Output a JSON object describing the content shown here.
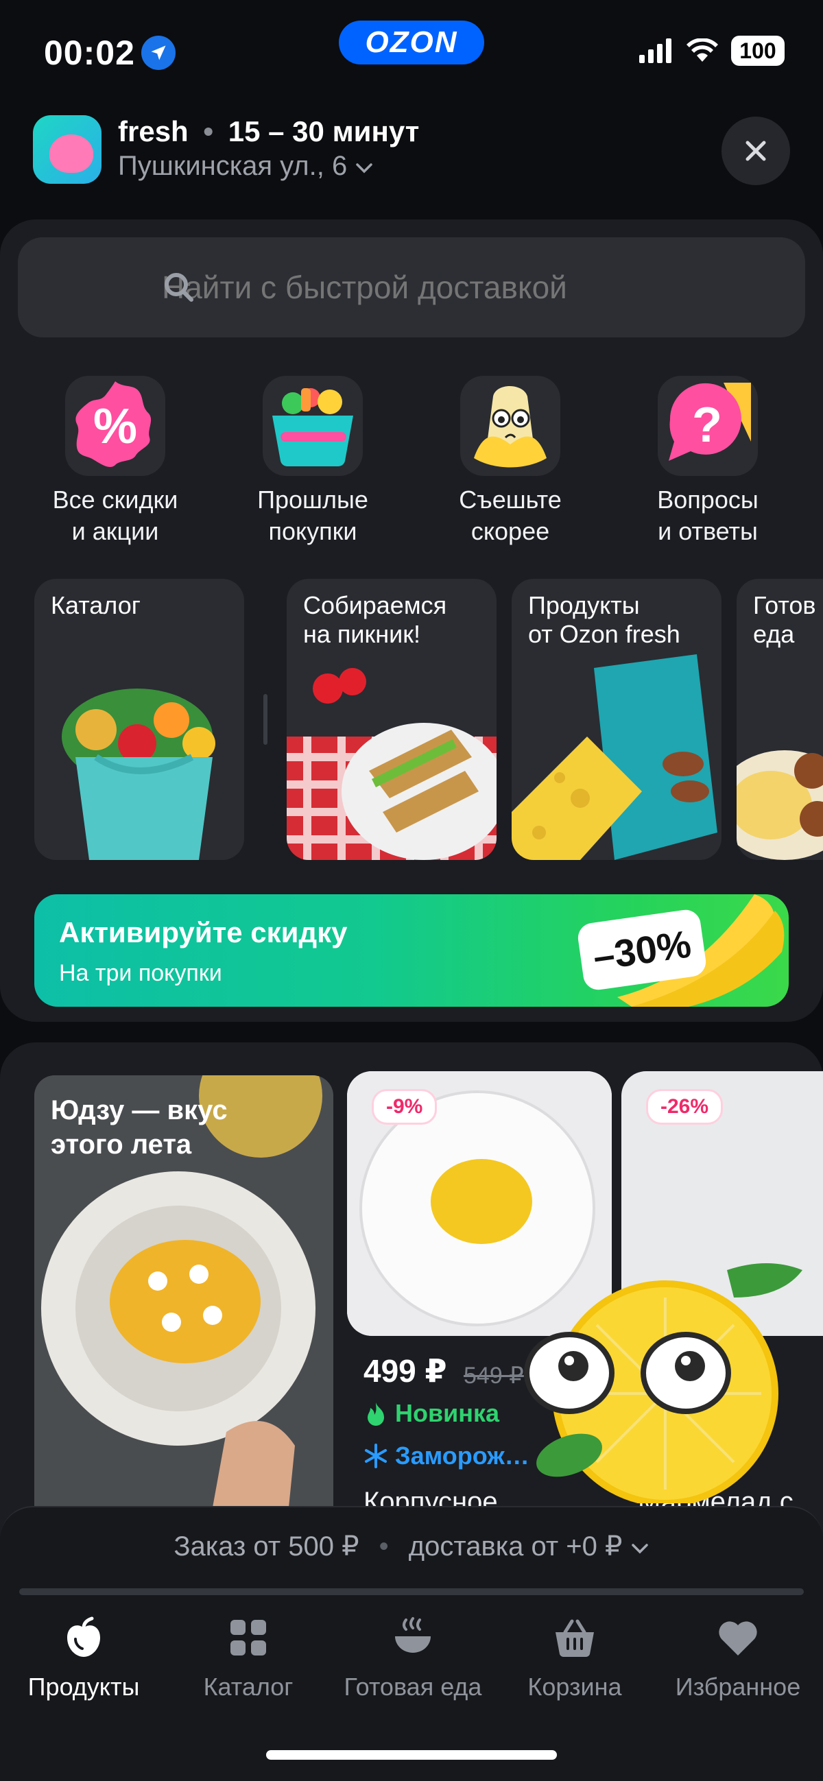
{
  "status_bar": {
    "time": "00:02",
    "brand": "OZON",
    "battery": "100"
  },
  "header": {
    "store_name": "fresh",
    "separator": "•",
    "delivery_time": "15 – 30 минут",
    "address": "Пушкинская ул., 6"
  },
  "search": {
    "placeholder": "Найти с быстрой доставкой"
  },
  "quick_actions": [
    {
      "label": "Все скидки\nи акции",
      "icon": "percent-badge-icon"
    },
    {
      "label": "Прошлые\nпокупки",
      "icon": "grocery-basket-icon"
    },
    {
      "label": "Съешьте\nскорее",
      "icon": "banana-character-icon"
    },
    {
      "label": "Вопросы\nи ответы",
      "icon": "question-bubble-icon"
    }
  ],
  "tiles": [
    {
      "title": "Каталог"
    },
    {
      "title": "Собираемся\nна пикник!"
    },
    {
      "title": "Продукты\nот Ozon fresh"
    },
    {
      "title": "Готов\nеда"
    }
  ],
  "banner": {
    "title": "Активируйте скидку",
    "subtitle": "На три покупки",
    "badge": "–30%"
  },
  "products": {
    "promo_title": "Юдзу — вкус\nэтого лета",
    "items": [
      {
        "discount": "-9%",
        "price": "499 ₽",
        "old_price": "549 ₽",
        "tag_new": "Новинка",
        "tag_frozen": "Заморож…",
        "name": "Корпусное"
      },
      {
        "discount": "-26%",
        "name": "Мармелад с"
      }
    ]
  },
  "order_bar": {
    "min_order": "Заказ от 500 ₽",
    "delivery": "доставка от +0 ₽"
  },
  "bottom_nav": [
    {
      "label": "Продукты",
      "icon": "apple-icon",
      "active": true
    },
    {
      "label": "Каталог",
      "icon": "grid-icon",
      "active": false
    },
    {
      "label": "Готовая еда",
      "icon": "hot-dish-icon",
      "active": false
    },
    {
      "label": "Корзина",
      "icon": "basket-icon",
      "active": false
    },
    {
      "label": "Избранное",
      "icon": "heart-icon",
      "active": false
    }
  ],
  "colors": {
    "accent_blue": "#0063ff",
    "green": "#2fd36f",
    "pink": "#f0296a",
    "frozen_blue": "#2a9bff"
  }
}
